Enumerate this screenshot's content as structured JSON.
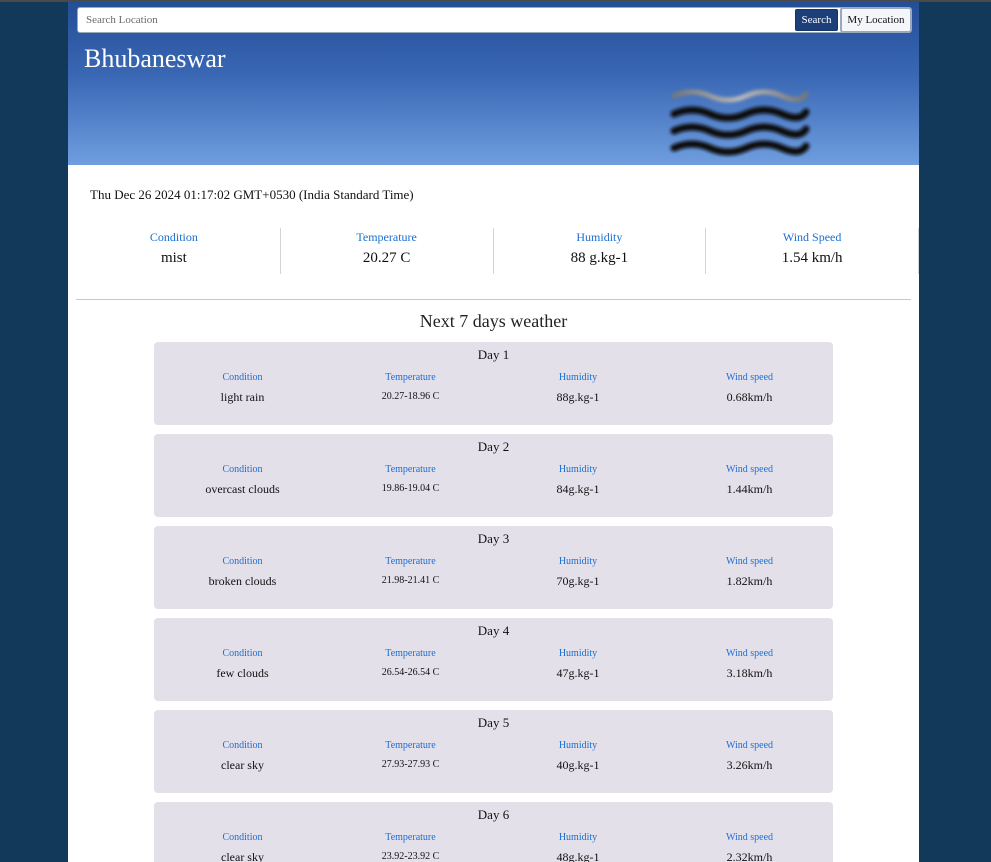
{
  "search": {
    "placeholder": "Search Location",
    "button_label": "Search",
    "location_button_label": "My Location"
  },
  "current": {
    "city": "Bhubaneswar",
    "icon": "mist-icon",
    "datetime": "Thu Dec 26 2024 01:17:02 GMT+0530 (India Standard Time)",
    "stats": [
      {
        "label": "Condition",
        "value": "mist"
      },
      {
        "label": "Temperature",
        "value": "20.27 C"
      },
      {
        "label": "Humidity",
        "value": "88 g.kg-1"
      },
      {
        "label": "Wind Speed",
        "value": "1.54 km/h"
      }
    ]
  },
  "forecast": {
    "title": "Next 7 days weather",
    "column_labels": {
      "condition": "Condition",
      "temperature": "Temperature",
      "humidity": "Humidity",
      "wind": "Wind speed"
    },
    "days": [
      {
        "title": "Day 1",
        "condition": "light rain",
        "temperature": "20.27-18.96 C",
        "humidity": "88g.kg-1",
        "wind": "0.68km/h"
      },
      {
        "title": "Day 2",
        "condition": "overcast clouds",
        "temperature": "19.86-19.04 C",
        "humidity": "84g.kg-1",
        "wind": "1.44km/h"
      },
      {
        "title": "Day 3",
        "condition": "broken clouds",
        "temperature": "21.98-21.41 C",
        "humidity": "70g.kg-1",
        "wind": "1.82km/h"
      },
      {
        "title": "Day 4",
        "condition": "few clouds",
        "temperature": "26.54-26.54 C",
        "humidity": "47g.kg-1",
        "wind": "3.18km/h"
      },
      {
        "title": "Day 5",
        "condition": "clear sky",
        "temperature": "27.93-27.93 C",
        "humidity": "40g.kg-1",
        "wind": "3.26km/h"
      },
      {
        "title": "Day 6",
        "condition": "clear sky",
        "temperature": "23.92-23.92 C",
        "humidity": "48g.kg-1",
        "wind": "2.32km/h"
      }
    ]
  },
  "colors": {
    "page_background": "#12385a",
    "header_gradient_top": "#244e96",
    "header_gradient_bottom": "#6f9edf",
    "label_blue": "#1a6fd1",
    "day_card": "#e4e0ea",
    "search_button": "#1c3f7a"
  }
}
